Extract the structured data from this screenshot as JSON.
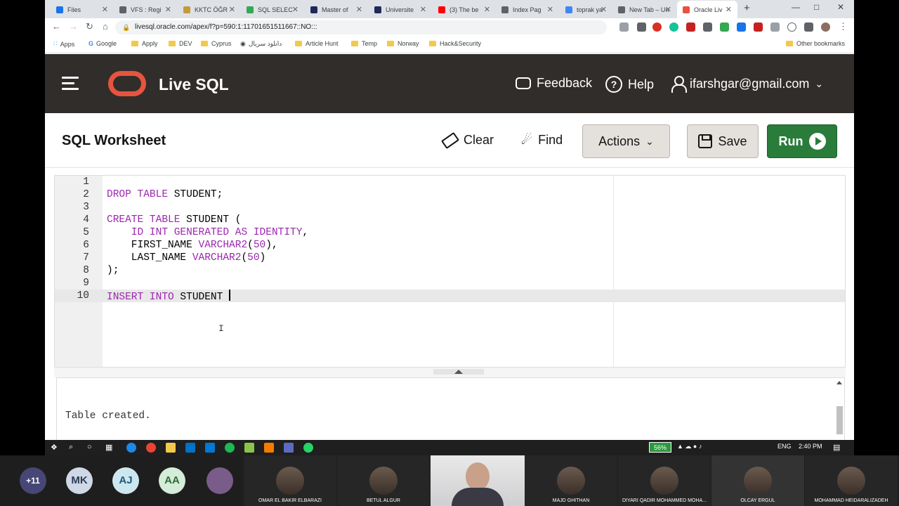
{
  "browser": {
    "tabs": [
      {
        "title": "Files",
        "color": "#1a73e8"
      },
      {
        "title": "VFS : Regi",
        "color": "#5f6368"
      },
      {
        "title": "KKTC ÖĞR",
        "color": "#c49a3a"
      },
      {
        "title": "SQL SELEC",
        "color": "#34a853"
      },
      {
        "title": "Master of",
        "color": "#1f2a5a"
      },
      {
        "title": "Universite",
        "color": "#1f2a5a"
      },
      {
        "title": "(3) The be",
        "color": "#ff0000"
      },
      {
        "title": "Index Pag",
        "color": "#5f6368"
      },
      {
        "title": "toprak ya",
        "color": "#4285f4"
      },
      {
        "title": "New Tab – Un",
        "color": "#5f6368"
      },
      {
        "title": "Oracle Liv",
        "color": "#e6543f"
      }
    ],
    "url": "livesql.oracle.com/apex/f?p=590:1:11701651511667::NO:::",
    "bookmarks": [
      "Apps",
      "Google",
      "Apply",
      "DEV",
      "Cyprus",
      "دانلود سریال",
      "Article Hunt",
      "Temp",
      "Norway",
      "Hack&Security"
    ],
    "other_bookmarks": "Other bookmarks"
  },
  "app": {
    "name": "Live SQL",
    "feedback": "Feedback",
    "help": "Help",
    "user": "ifarshgar@gmail.com"
  },
  "worksheet": {
    "title": "SQL Worksheet",
    "clear": "Clear",
    "find": "Find",
    "actions": "Actions",
    "save": "Save",
    "run": "Run"
  },
  "editor": {
    "line_numbers": [
      "1",
      "2",
      "3",
      "4",
      "5",
      "6",
      "7",
      "8",
      "9",
      "10"
    ],
    "active_line": 10
  },
  "output": {
    "text": "Table created."
  },
  "taskbar": {
    "battery": "56%",
    "language": "ENG",
    "time": "2:40 PM"
  },
  "meeting": {
    "avatars": [
      {
        "label": "+11",
        "bg": "#464775",
        "fg": "#ffffff"
      },
      {
        "label": "MK",
        "bg": "#cfd8e6",
        "fg": "#2b3a55"
      },
      {
        "label": "AJ",
        "bg": "#cde7f0",
        "fg": "#1f5a7a"
      },
      {
        "label": "AA",
        "bg": "#d4ecd8",
        "fg": "#2f6b3a"
      }
    ],
    "participants": [
      "OMAR EL BAKIR ELBARAZI",
      "BETÜL ALGÜR",
      "MAJD GHITHAN",
      "DIYARI QADIR MOHAMMED MOHA...",
      "OLCAY ERGÜL",
      "MOHAMMAD HEIDARALIZADEH"
    ]
  }
}
